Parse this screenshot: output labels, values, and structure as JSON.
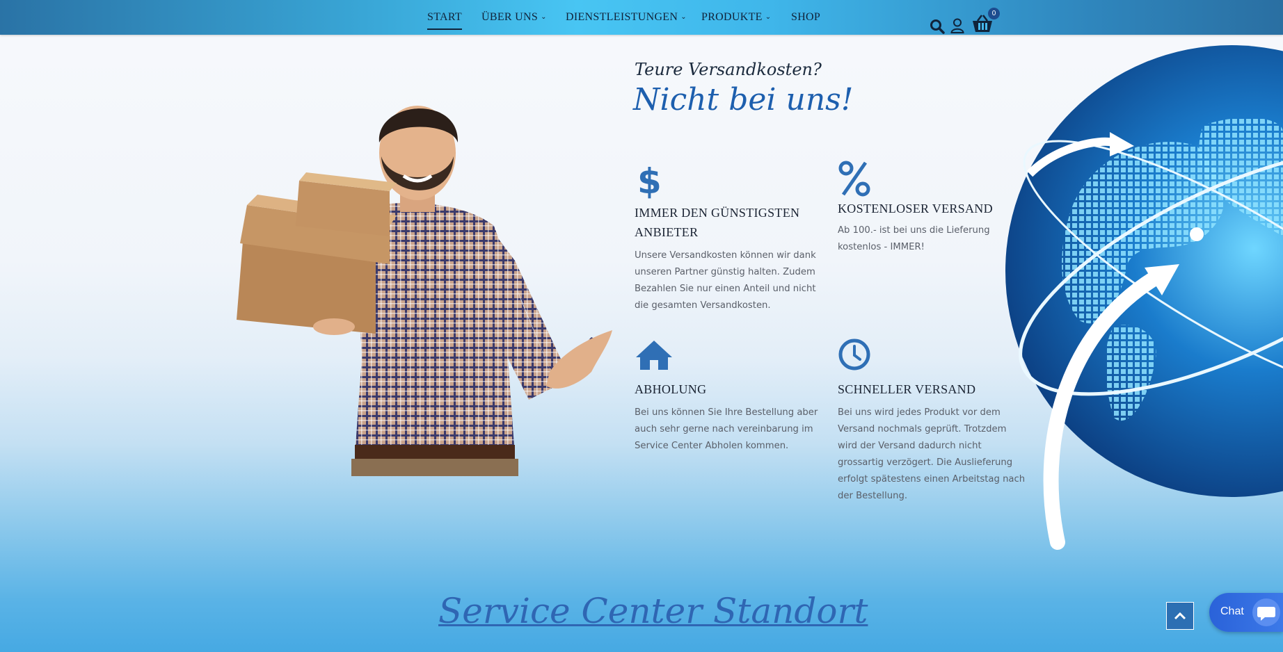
{
  "nav": {
    "items": [
      {
        "label": "START",
        "active": true
      },
      {
        "label": "ÜBER UNS",
        "dropdown": true
      },
      {
        "label": "DIENSTLEISTUNGEN",
        "dropdown": true
      },
      {
        "label": "PRODUKTE",
        "dropdown": true
      },
      {
        "label": "SHOP"
      }
    ],
    "icons": [
      "search-icon",
      "user-icon",
      "basket-icon"
    ],
    "cart_count": "0"
  },
  "hero": {
    "eyebrow": "Teure Versandkosten?",
    "headline": "Nicht bei uns!"
  },
  "features": [
    {
      "icon": "dollar-icon",
      "title": "IMMER DEN GÜNSTIGSTEN ANBIETER",
      "text": "Unsere Versandkosten können wir dank unseren Partner günstig halten. Zudem Bezahlen Sie nur einen Anteil und nicht die gesamten Versandkosten."
    },
    {
      "icon": "percent-icon",
      "title": "KOSTENLOSER VERSAND",
      "text": "Ab 100.- ist bei uns die Lieferung kostenlos - IMMER!"
    },
    {
      "icon": "home-icon",
      "title": "ABHOLUNG",
      "text": "Bei uns können Sie Ihre Bestellung aber auch sehr gerne nach vereinbarung im Service Center Abholen kommen."
    },
    {
      "icon": "clock-icon",
      "title": "SCHNELLER VERSAND",
      "text": "Bei uns wird jedes Produkt vor dem Versand nochmals geprüft. Trotzdem wird der Versand dadurch nicht grossartig verzögert. Die Auslieferung erfolgt spätestens einen Arbeitstag nach der Bestellung."
    }
  ],
  "service": {
    "title": "Service Center Standort"
  },
  "chat": {
    "label": "Chat"
  },
  "colors": {
    "accent": "#1d5fae",
    "icon": "#2f6fb5",
    "nav": "#48c5f3"
  }
}
